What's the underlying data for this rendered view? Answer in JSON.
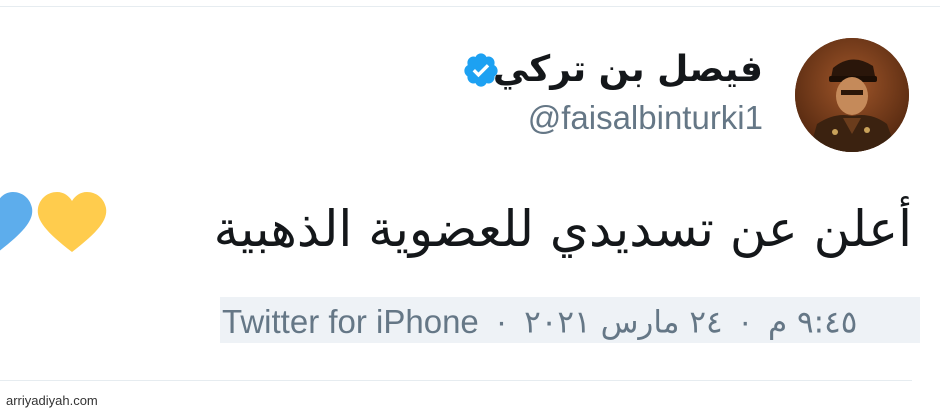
{
  "tweet": {
    "author": {
      "display_name": "فيصل بن تركي",
      "handle": "@faisalbinturki1",
      "verified": true,
      "avatar_icon": "avatar-photo"
    },
    "text": "أعلن عن تسديدي للعضوية الذهبية",
    "emojis": [
      "yellow-heart",
      "blue-heart"
    ],
    "time": "٩:٤٥ م",
    "date": "٢٤ مارس ٢٠٢١",
    "source": "Twitter for iPhone",
    "separator": "·"
  },
  "colors": {
    "verified_blue": "#1da1f2",
    "secondary_text": "#657786",
    "primary_text": "#14171a",
    "heart_yellow": "#ffcc4d",
    "heart_blue": "#5dadec"
  },
  "watermark": "arriyadiyah.com"
}
